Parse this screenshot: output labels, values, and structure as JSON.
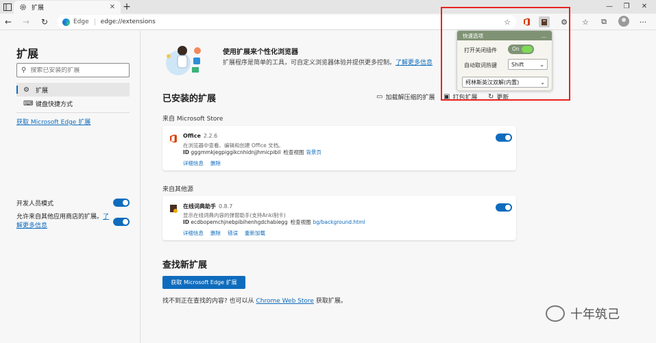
{
  "browser": {
    "tab_title": "扩展",
    "address_brand": "Edge",
    "address_url": "edge://extensions",
    "icons": {
      "tab_actions": "tab-actions-icon",
      "back": "back-arrow-icon",
      "forward": "forward-arrow-icon",
      "refresh": "refresh-icon",
      "favorite": "add-favorite-icon"
    }
  },
  "sidebar": {
    "title": "扩展",
    "search_placeholder": "搜索已安装的扩展",
    "items": [
      {
        "label": "扩展",
        "icon": "gear-icon"
      },
      {
        "label": "键盘快捷方式",
        "icon": "keyboard-icon"
      }
    ],
    "get_extensions_link": "获取 Microsoft Edge 扩展",
    "developer_mode_label": "开发人员模式",
    "allow_other_stores_text": "允许来自其他应用商店的扩展。",
    "learn_more_link": "了解更多信息"
  },
  "banner": {
    "title": "使用扩展来个性化浏览器",
    "description": "扩展程序是简单的工具，可自定义浏览器体验并提供更多控制。",
    "learn_more": "了解更多信息"
  },
  "installed": {
    "heading": "已安装的扩展",
    "load_unpacked": "加载解压缩的扩展",
    "pack": "打包扩展",
    "update": "更新",
    "store_source_label": "来自 Microsoft Store",
    "other_source_label": "来自其他源",
    "extensions": [
      {
        "name": "Office",
        "version": "2.2.6",
        "description": "在浏览器中查看、编辑和创建 Office 文档。",
        "id_label": "ID",
        "id": "gggmmkjegpiggikcnhidnjjhmicpibll",
        "inspect_label": "检查视图",
        "inspect_link": "背景页",
        "actions": [
          "详细信息",
          "删除"
        ],
        "enabled": true
      },
      {
        "name": "在线词典助手",
        "version": "0.8.7",
        "description": "显示在线词典内容的弹窗助手(支持Anki制卡)",
        "id_label": "ID",
        "id": "ecdbopemchjnebpibihenhgdchabiegg",
        "inspect_label": "检查视图",
        "inspect_link": "bg/background.html",
        "actions": [
          "详细信息",
          "删除",
          "错误",
          "重新加载"
        ],
        "enabled": true
      }
    ]
  },
  "find": {
    "heading": "查找新扩展",
    "button": "获取 Microsoft Edge 扩展",
    "text_before": "找不到正在查找的内容? 也可以从",
    "link": "Chrome Web Store",
    "text_after": "获取扩展。"
  },
  "popup": {
    "header": "快速选项",
    "header_menu": "...",
    "row1_label": "打开关闭插件",
    "toggle_label": "On",
    "row2_label": "自动取词热键",
    "hotkey": "Shift",
    "dictionary": "柯林斯英汉双解(内置)"
  },
  "watermark": "十年筑己",
  "colors": {
    "accent": "#0f6cbd",
    "popup_header": "#7f9374",
    "popup_toggle_knob": "#7ed957",
    "highlight_box": "#e8221f"
  }
}
